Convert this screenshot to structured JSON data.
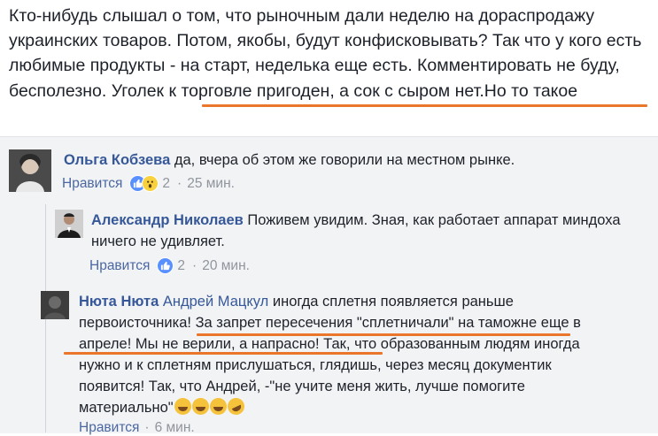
{
  "post": {
    "text_part1": "Кто-нибудь слышал о том, что рыночным дали неделю на дораспродажу украинских товаров. Потом, якобы, будут конфисковывать? Так что у кого есть любимые продукты - на старт, неделька еще есть. Комментировать не буду, бесполезно. ",
    "text_highlight": "Уголек к торговле пригоден, а сок с сыром нет.",
    "text_part2": "Но то такое"
  },
  "comments": [
    {
      "author": "Ольга Кобзева",
      "text": "да, вчера об этом же говорили на местном рынке.",
      "like_label": "Нравится",
      "reactions_count": "2",
      "time": "25 мин."
    },
    {
      "author": "Александр Николаев",
      "text": "Поживем увидим. Зная, как работает аппарат миндоха ничего не удивляет.",
      "like_label": "Нравится",
      "reactions_count": "2",
      "time": "20 мин."
    },
    {
      "author": "Нюта Нюта",
      "mention": "Андрей Мацкул",
      "text_part1": "иногда сплетня появляется раньше первоисточника! ",
      "text_highlight": "За запрет пересечения \"сплетничали\" на таможне еще в апреле! Мы не верили, а напрасно!",
      "text_part2": " Так, что образованным людям иногда нужно и к сплетням прислушаться, глядишь, через месяц документик появится! Так, что Андрей, -\"не учите меня жить, лучше помогите материально\"",
      "like_label": "Нравится",
      "time": "6 мин."
    }
  ],
  "ui": {
    "separator": "·"
  },
  "colors": {
    "link": "#365899",
    "underline": "#e9762a",
    "meta": "#90949c",
    "comment_bg": "#f2f3f5"
  },
  "icons": [
    "like-reaction-icon",
    "wow-reaction-icon",
    "grinning-face-emoji",
    "rofl-face-emoji"
  ]
}
